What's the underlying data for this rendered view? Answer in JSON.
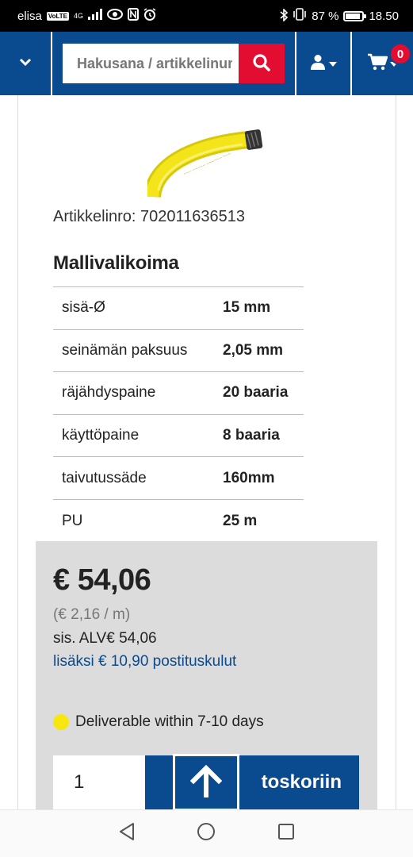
{
  "status_bar": {
    "carrier": "elisa",
    "volte": "VoLTE",
    "network": "4G",
    "battery_percent": "87 %",
    "battery_level": 0.87,
    "time": "18.50",
    "icons": [
      "signal-icon",
      "eye-icon",
      "nfc-icon",
      "alarm-icon",
      "bluetooth-icon",
      "vibrate-icon",
      "battery-icon"
    ]
  },
  "header": {
    "menu_icon": "chevron-down-icon",
    "search": {
      "placeholder": "Hakusana / artikkelinumero"
    },
    "cart_count": "0",
    "colors": {
      "background": "#0a4a8f",
      "search_button": "#e30d32",
      "badge": "#e30d32"
    }
  },
  "product": {
    "image": "yellow-garden-hose",
    "article_number": "Artikkelinro: 702011636513",
    "section_title": "Mallivalikoima",
    "specs": [
      {
        "label": "sisä-Ø",
        "value": "15 mm"
      },
      {
        "label": "seinämän paksuus",
        "value": "2,05 mm"
      },
      {
        "label": "räjähdyspaine",
        "value": "20 baaria"
      },
      {
        "label": "käyttöpaine",
        "value": "8 baaria"
      },
      {
        "label": "taivutussäde",
        "value": "160mm"
      },
      {
        "label": "PU",
        "value": "25 m"
      }
    ]
  },
  "price": {
    "main": "€ 54,06",
    "unit": "(€ 2,16 / m)",
    "vat": "sis. ALV€ 54,06",
    "shipping": "lisäksi € 10,90 postituskulut",
    "delivery": "Deliverable within 7-10 days",
    "delivery_color": "#f7e60f",
    "quantity": "1",
    "cart_button": "toskoriin"
  },
  "scroll_top_icon": "arrow-up-icon",
  "nav_bar": [
    "back-icon",
    "home-icon",
    "recents-icon"
  ]
}
